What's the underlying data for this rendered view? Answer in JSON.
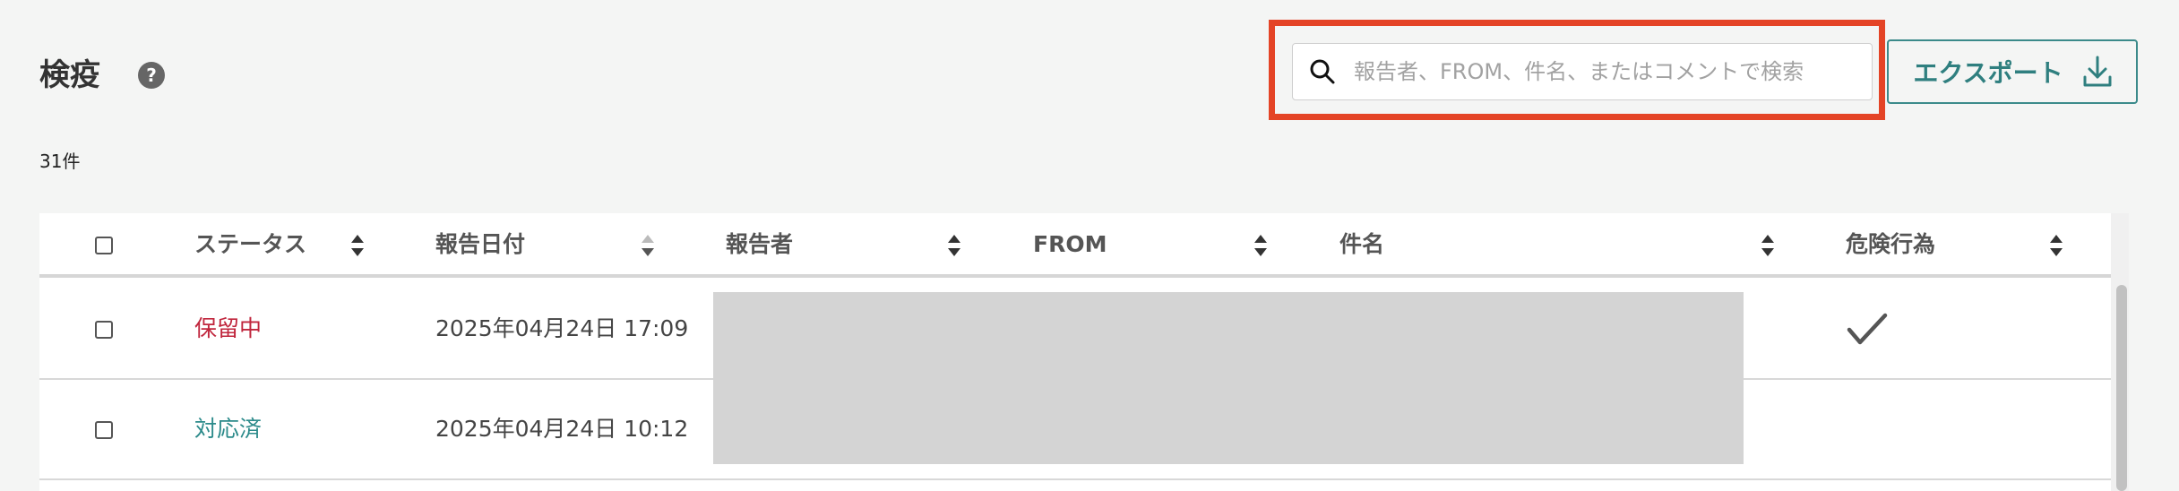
{
  "header": {
    "title": "検疫",
    "count_label": "31件"
  },
  "search": {
    "placeholder": "報告者、FROM、件名、またはコメントで検索",
    "value": ""
  },
  "export": {
    "label": "エクスポート"
  },
  "table": {
    "columns": [
      {
        "key": "status",
        "label": "ステータス"
      },
      {
        "key": "report_date",
        "label": "報告日付"
      },
      {
        "key": "reporter",
        "label": "報告者"
      },
      {
        "key": "from",
        "label": "FROM"
      },
      {
        "key": "subject",
        "label": "件名"
      },
      {
        "key": "dangerous_action",
        "label": "危険行為"
      }
    ],
    "rows": [
      {
        "status": "保留中",
        "status_color": "#c0263d",
        "report_date": "2025年04月24日 17:09",
        "dangerous_action": true
      },
      {
        "status": "対応済",
        "status_color": "#2b8a8a",
        "report_date": "2025年04月24日 10:12",
        "dangerous_action": false
      }
    ]
  },
  "colors": {
    "accent": "#2f7f7f",
    "highlight": "#e44426",
    "pending": "#c0263d",
    "resolved": "#2b8a8a"
  },
  "icons": {
    "help": "help-circle-icon",
    "search": "search-icon",
    "export": "download-icon",
    "sort": "sort-icon",
    "check": "check-icon"
  }
}
